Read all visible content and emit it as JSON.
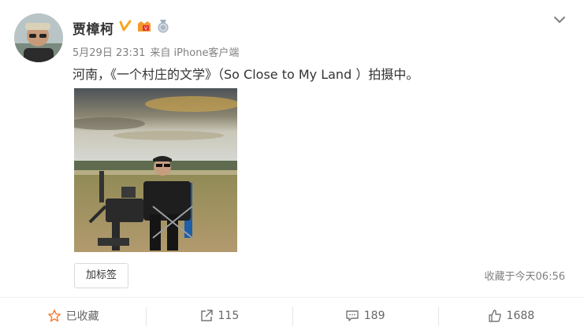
{
  "post": {
    "author": "贾樟柯",
    "time": "5月29日 23:31",
    "source": "来自 iPhone客户端",
    "text": "河南，《一个村庄的文学》（So Close to My Land ）拍摄中。",
    "tag_button": "加标签",
    "fav_time": "收藏于今天06:56"
  },
  "actions": {
    "favorite": "已收藏",
    "share": "115",
    "comment": "189",
    "like": "1688"
  },
  "colors": {
    "verified": "#f5a623",
    "fav_star": "#f77b2e",
    "meta": "#808080"
  },
  "icons": [
    "verified-icon",
    "vip-icon",
    "medal-icon",
    "chevron-down-icon",
    "star-icon",
    "share-icon",
    "comment-icon",
    "like-icon"
  ]
}
